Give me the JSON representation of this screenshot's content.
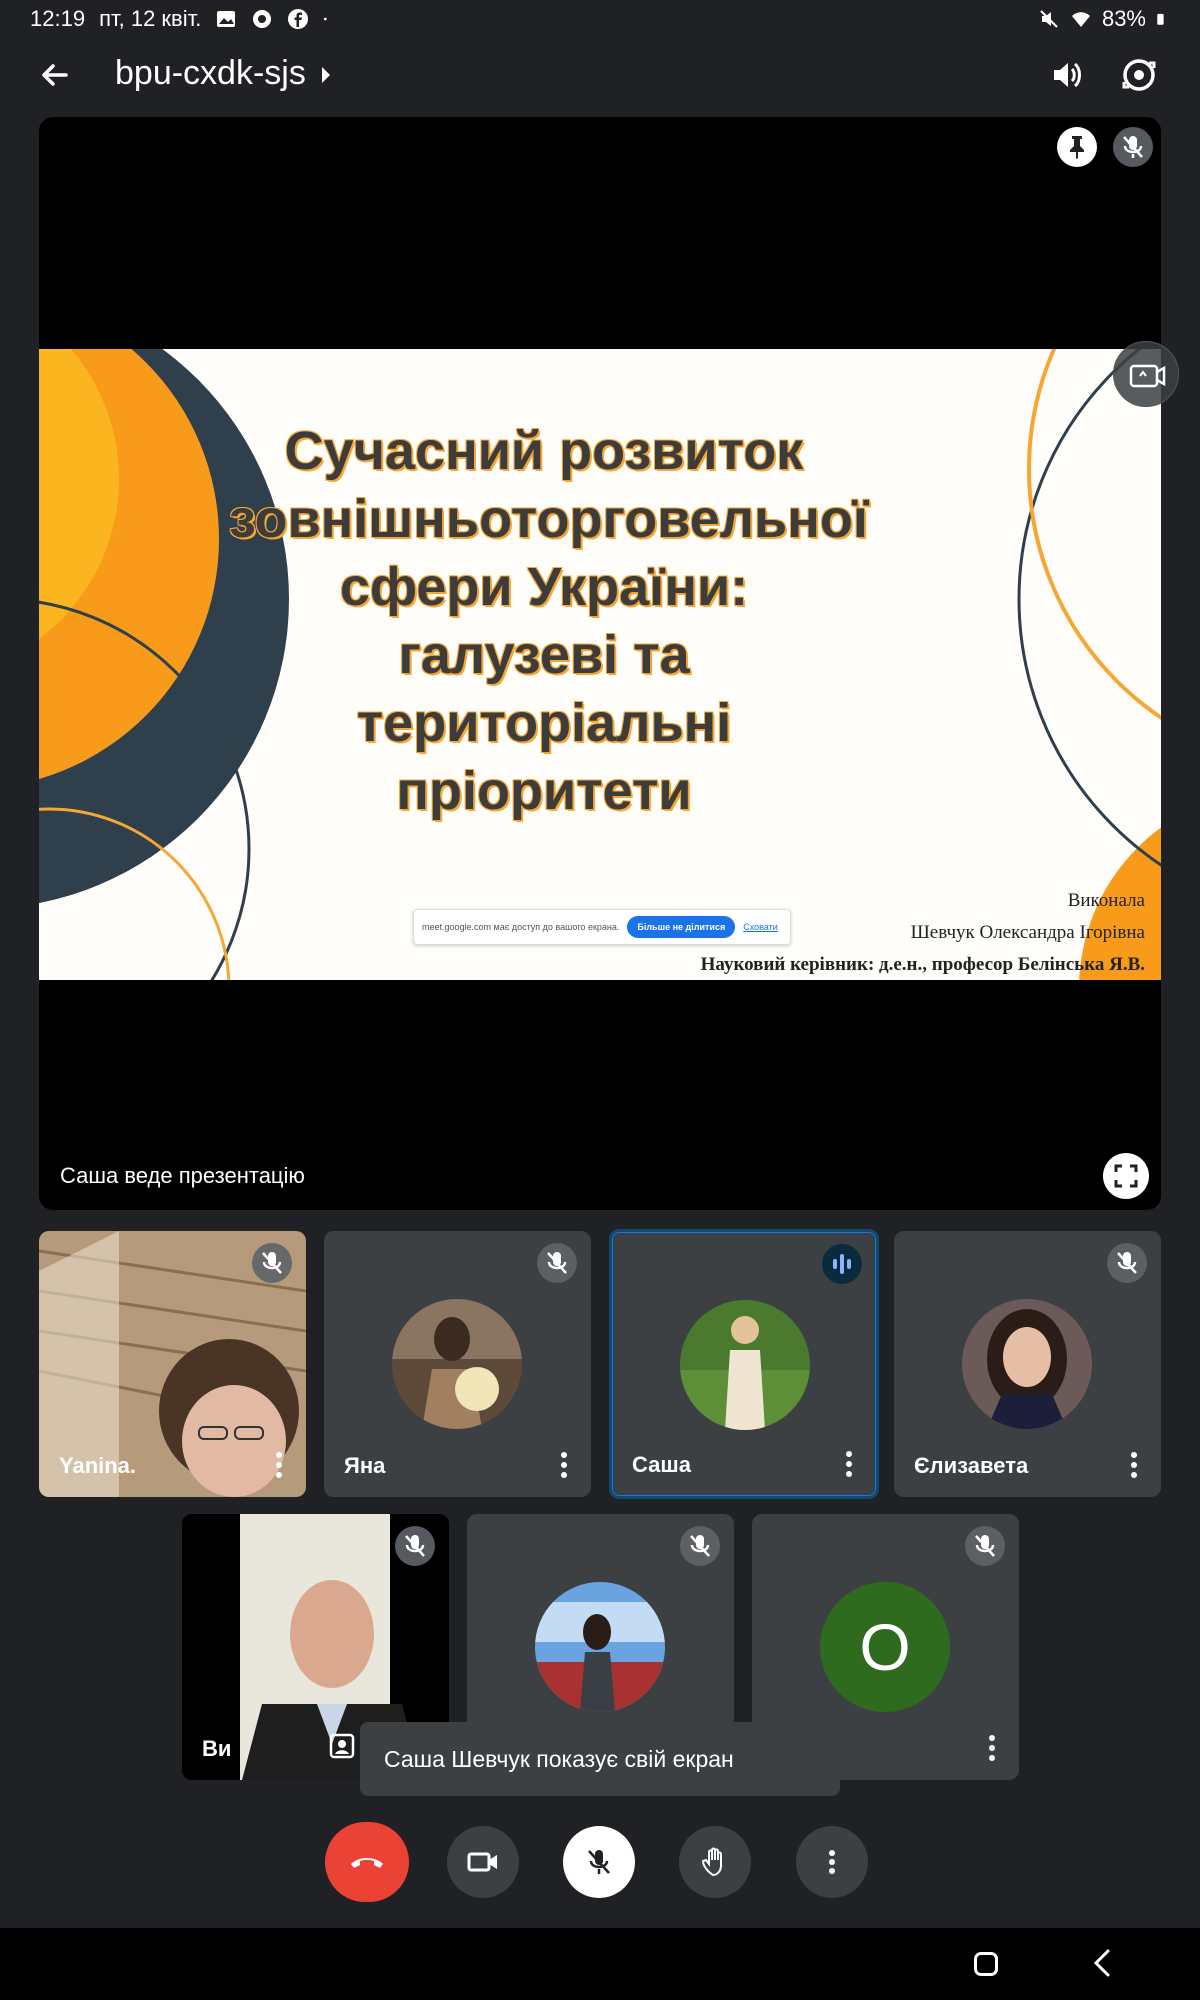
{
  "status_bar": {
    "time": "12:19",
    "date": "пт, 12 квіт.",
    "battery": "83%"
  },
  "header": {
    "meeting_code": "bpu-cxdk-sjs"
  },
  "presentation": {
    "presenting_label": "Саша веде презентацію",
    "slide": {
      "title": "Сучасний розвиток зовнішньоторговельної сфери України: галузеві та територіальні пріоритети",
      "author_line1": "Виконала",
      "author_line2": "Шевчук Олександра Ігорівна",
      "author_line3": "Науковий керівник: д.е.н., професор Белінська Я.В."
    },
    "share_bar": {
      "text": "meet.google.com має доступ до вашого екрана.",
      "stop_label": "Більше не ділитися",
      "hide_label": "Сховати"
    }
  },
  "participants": [
    {
      "name": "Yanina."
    },
    {
      "name": "Яна"
    },
    {
      "name": "Саша"
    },
    {
      "name": "Єлизавета"
    },
    {
      "name": "Ви"
    },
    {
      "name": ""
    },
    {
      "name": "",
      "initial": "O"
    }
  ],
  "toast": {
    "text": "Саша Шевчук показує свій екран"
  },
  "colors": {
    "background": "#202124",
    "tile": "#3c4043",
    "hangup": "#ea4335",
    "accent_orange": "#f6a733",
    "avatar_green": "#2e6b1f"
  }
}
